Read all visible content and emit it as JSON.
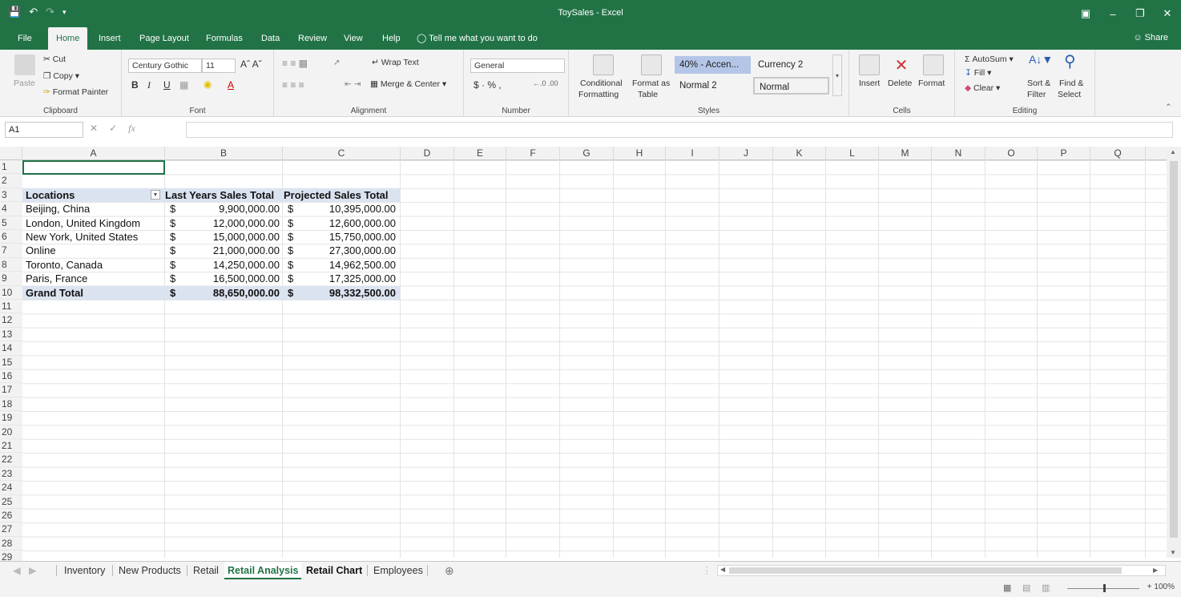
{
  "app": {
    "title": "ToySales  -  Excel",
    "share_label": "Share"
  },
  "colors": {
    "brand": "#217346",
    "pivot_header": "#dce3f0"
  },
  "menu": {
    "tabs": [
      "File",
      "Home",
      "Insert",
      "Page Layout",
      "Formulas",
      "Data",
      "Review",
      "View",
      "Help"
    ],
    "active": "Home",
    "tell_me": "Tell me what you want to do"
  },
  "ribbon": {
    "clipboard": {
      "paste": "Paste",
      "cut": "Cut",
      "copy": "Copy",
      "format_painter": "Format Painter",
      "label": "Clipboard"
    },
    "font": {
      "name": "Century Gothic",
      "size": "11",
      "label": "Font"
    },
    "alignment": {
      "wrap": "Wrap Text",
      "merge": "Merge & Center",
      "label": "Alignment"
    },
    "number": {
      "format": "General",
      "label": "Number"
    },
    "styles": {
      "conditional": "Conditional",
      "conditional2": "Formatting",
      "format_as": "Format as",
      "format_as2": "Table",
      "cells": [
        "40% - Accen...",
        "Currency 2",
        "Normal 2",
        "Normal"
      ],
      "label": "Styles"
    },
    "cells": {
      "insert": "Insert",
      "delete": "Delete",
      "format": "Format",
      "label": "Cells"
    },
    "editing": {
      "autosum": "AutoSum",
      "fill": "Fill",
      "clear": "Clear",
      "sort": "Sort &",
      "sort2": "Filter",
      "find": "Find &",
      "find2": "Select",
      "label": "Editing"
    }
  },
  "formula_bar": {
    "name_box": "A1",
    "fx": "fx",
    "value": ""
  },
  "grid": {
    "columns": [
      "A",
      "B",
      "C",
      "D",
      "E",
      "F",
      "G",
      "H",
      "I",
      "J",
      "K",
      "L",
      "M",
      "N",
      "O",
      "P",
      "Q"
    ],
    "rows": [
      "1",
      "2",
      "3",
      "4",
      "5",
      "6",
      "7",
      "8",
      "9",
      "10",
      "11",
      "12",
      "13",
      "14",
      "15",
      "16",
      "17",
      "18",
      "19",
      "20",
      "21",
      "22",
      "23",
      "24",
      "25",
      "26",
      "27",
      "28",
      "29"
    ],
    "pivot": {
      "headers": [
        "Locations",
        "Last Years Sales Total",
        "Projected Sales Total"
      ],
      "currency": "$",
      "rows": [
        {
          "loc": "Beijing, China",
          "last": "9,900,000.00",
          "proj": "10,395,000.00"
        },
        {
          "loc": "London, United Kingdom",
          "last": "12,000,000.00",
          "proj": "12,600,000.00"
        },
        {
          "loc": "New York, United States",
          "last": "15,000,000.00",
          "proj": "15,750,000.00"
        },
        {
          "loc": "Online",
          "last": "21,000,000.00",
          "proj": "27,300,000.00"
        },
        {
          "loc": "Toronto, Canada",
          "last": "14,250,000.00",
          "proj": "14,962,500.00"
        },
        {
          "loc": "Paris, France",
          "last": "16,500,000.00",
          "proj": "17,325,000.00"
        }
      ],
      "total": {
        "loc": "Grand Total",
        "last": "88,650,000.00",
        "proj": "98,332,500.00"
      }
    }
  },
  "sheets": {
    "tabs": [
      "Inventory",
      "New Products",
      "Retail",
      "Retail Analysis",
      "Retail Chart",
      "Employees"
    ],
    "active": "Retail Analysis"
  },
  "status": {
    "zoom": "100%"
  }
}
